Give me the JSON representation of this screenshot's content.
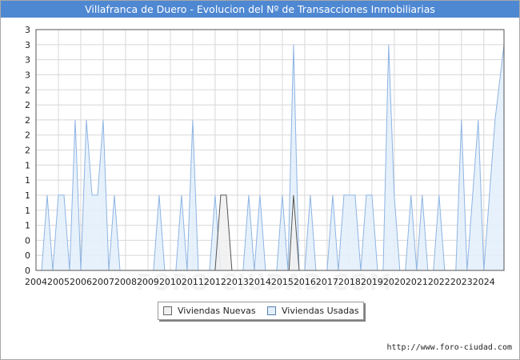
{
  "title": "Villafranca de Duero - Evolucion del Nº de Transacciones Inmobiliarias",
  "source": "http://www.foro-ciudad.com",
  "watermark": "FORO-CIUDAD.COM",
  "colors": {
    "title_bg": "#4f88d2",
    "nuevas_fill": "#f0f0f0",
    "nuevas_line": "#555555",
    "usadas_fill": "#e3effb",
    "usadas_line": "#8fb4e3",
    "grid": "#d8d8d8"
  },
  "chart_data": {
    "type": "area",
    "xlim": [
      2004,
      2024.9
    ],
    "ylim": [
      0,
      3.2
    ],
    "y_tick_values": [
      0,
      0.2,
      0.4,
      0.6,
      0.8,
      1.0,
      1.2,
      1.4,
      1.6,
      1.8,
      2.0,
      2.2,
      2.4,
      2.6,
      2.8,
      3.0,
      3.2
    ],
    "y_tick_labels": [
      "0",
      "0",
      "0",
      "1",
      "1",
      "1",
      "1",
      "1",
      "2",
      "2",
      "2",
      "2",
      "2",
      "3",
      "3",
      "3",
      "3"
    ],
    "x_tick_labels": [
      "2004",
      "2005",
      "2006",
      "2007",
      "2008",
      "2009",
      "2010",
      "2011",
      "2012",
      "2013",
      "2014",
      "2015",
      "2016",
      "2017",
      "2018",
      "2019",
      "2020",
      "2021",
      "2022",
      "2023",
      "2024"
    ],
    "grid": true,
    "legend_position": "bottom-center",
    "series": [
      {
        "name": "Viviendas Nuevas",
        "points": [
          [
            2004,
            0
          ],
          [
            2012.0,
            0
          ],
          [
            2012.25,
            1
          ],
          [
            2012.5,
            1
          ],
          [
            2012.75,
            0
          ],
          [
            2015.3,
            0
          ],
          [
            2015.5,
            1
          ],
          [
            2015.75,
            0
          ],
          [
            2024.9,
            0
          ]
        ]
      },
      {
        "name": "Viviendas Usadas",
        "points": [
          [
            2004,
            0
          ],
          [
            2004.25,
            0
          ],
          [
            2004.5,
            1
          ],
          [
            2004.75,
            0
          ],
          [
            2005.0,
            1
          ],
          [
            2005.25,
            1
          ],
          [
            2005.5,
            0
          ],
          [
            2005.75,
            2
          ],
          [
            2006.0,
            0
          ],
          [
            2006.25,
            2
          ],
          [
            2006.5,
            1
          ],
          [
            2006.75,
            1
          ],
          [
            2007.0,
            2
          ],
          [
            2007.25,
            0
          ],
          [
            2007.5,
            1
          ],
          [
            2007.75,
            0
          ],
          [
            2008.0,
            0
          ],
          [
            2008.25,
            0
          ],
          [
            2008.5,
            0
          ],
          [
            2008.75,
            0
          ],
          [
            2009.0,
            0
          ],
          [
            2009.25,
            0
          ],
          [
            2009.5,
            1
          ],
          [
            2009.75,
            0
          ],
          [
            2010.0,
            0
          ],
          [
            2010.25,
            0
          ],
          [
            2010.5,
            1
          ],
          [
            2010.75,
            0
          ],
          [
            2011.0,
            2
          ],
          [
            2011.25,
            0
          ],
          [
            2011.5,
            0
          ],
          [
            2011.75,
            0
          ],
          [
            2012.0,
            1
          ],
          [
            2012.25,
            0
          ],
          [
            2012.5,
            0
          ],
          [
            2012.75,
            0
          ],
          [
            2013.0,
            0
          ],
          [
            2013.25,
            0
          ],
          [
            2013.5,
            1
          ],
          [
            2013.75,
            0
          ],
          [
            2014.0,
            1
          ],
          [
            2014.25,
            0
          ],
          [
            2014.5,
            0
          ],
          [
            2014.75,
            0
          ],
          [
            2015.0,
            1
          ],
          [
            2015.25,
            0
          ],
          [
            2015.5,
            3
          ],
          [
            2015.75,
            0
          ],
          [
            2016.0,
            0
          ],
          [
            2016.25,
            1
          ],
          [
            2016.5,
            0
          ],
          [
            2016.75,
            0
          ],
          [
            2017.0,
            0
          ],
          [
            2017.25,
            1
          ],
          [
            2017.5,
            0
          ],
          [
            2017.75,
            1
          ],
          [
            2018.0,
            1
          ],
          [
            2018.25,
            1
          ],
          [
            2018.5,
            0
          ],
          [
            2018.75,
            1
          ],
          [
            2019.0,
            1
          ],
          [
            2019.25,
            0
          ],
          [
            2019.5,
            0
          ],
          [
            2019.75,
            3
          ],
          [
            2020.0,
            1
          ],
          [
            2020.25,
            0
          ],
          [
            2020.5,
            0
          ],
          [
            2020.75,
            1
          ],
          [
            2021.0,
            0
          ],
          [
            2021.25,
            1
          ],
          [
            2021.5,
            0
          ],
          [
            2021.75,
            0
          ],
          [
            2022.0,
            1
          ],
          [
            2022.25,
            0
          ],
          [
            2022.5,
            0
          ],
          [
            2022.75,
            0
          ],
          [
            2023.0,
            2
          ],
          [
            2023.25,
            0
          ],
          [
            2023.5,
            1
          ],
          [
            2023.75,
            2
          ],
          [
            2024.0,
            0
          ],
          [
            2024.25,
            1
          ],
          [
            2024.5,
            2
          ],
          [
            2024.9,
            3
          ]
        ]
      }
    ]
  }
}
